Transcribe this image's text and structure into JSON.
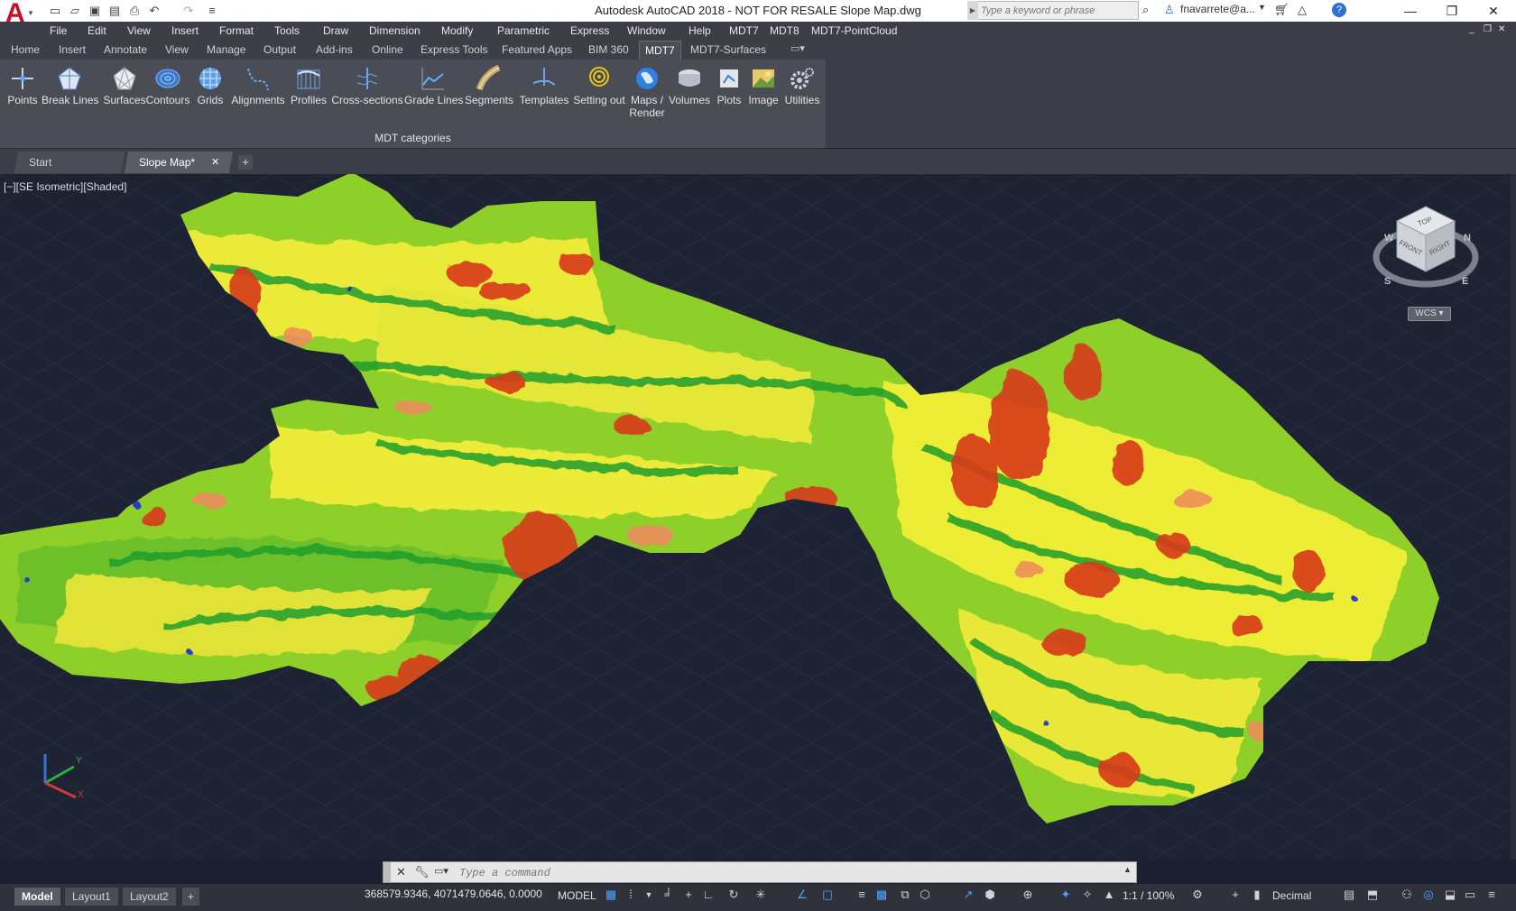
{
  "window": {
    "title": "Autodesk AutoCAD 2018 - NOT FOR RESALE    Slope Map.dwg",
    "search_placeholder": "Type a keyword or phrase",
    "user": "fnavarrete@a...",
    "app_letter": "A"
  },
  "menu": [
    "File",
    "Edit",
    "View",
    "Insert",
    "Format",
    "Tools",
    "Draw",
    "Dimension",
    "Modify",
    "Parametric",
    "Express",
    "Window",
    "Help",
    "MDT7",
    "MDT8",
    "MDT7-PointCloud"
  ],
  "ribbon_tabs": [
    "Home",
    "Insert",
    "Annotate",
    "View",
    "Manage",
    "Output",
    "Add-ins",
    "Online",
    "Express Tools",
    "Featured Apps",
    "BIM 360",
    "MDT7",
    "MDT7-Surfaces"
  ],
  "ribbon_active_tab": "MDT7",
  "ribbon_tools": [
    {
      "label": "Points",
      "icon": "points-icon"
    },
    {
      "label": "Break Lines",
      "icon": "break-lines-icon"
    },
    {
      "label": "Surfaces",
      "icon": "surfaces-icon"
    },
    {
      "label": "Contours",
      "icon": "contours-icon"
    },
    {
      "label": "Grids",
      "icon": "grids-icon"
    },
    {
      "label": "Alignments",
      "icon": "alignments-icon"
    },
    {
      "label": "Profiles",
      "icon": "profiles-icon"
    },
    {
      "label": "Cross-sections",
      "icon": "cross-sections-icon"
    },
    {
      "label": "Grade Lines",
      "icon": "grade-lines-icon"
    },
    {
      "label": "Segments",
      "icon": "segments-icon"
    },
    {
      "label": "Templates",
      "icon": "templates-icon"
    },
    {
      "label": "Setting out",
      "icon": "setting-out-icon"
    },
    {
      "label": "Maps /",
      "label2": "Render",
      "icon": "maps-render-icon"
    },
    {
      "label": "Volumes",
      "icon": "volumes-icon"
    },
    {
      "label": "Plots",
      "icon": "plots-icon"
    },
    {
      "label": "Image",
      "icon": "image-icon"
    },
    {
      "label": "Utilities",
      "icon": "utilities-icon"
    }
  ],
  "ribbon_panel_caption": "MDT categories",
  "doc_tabs": [
    "Start",
    "Slope Map*"
  ],
  "viewport": {
    "label": "[−][SE Isometric][Shaded]",
    "viewcube": {
      "top": "TOP",
      "front": "FRONT",
      "right": "RIGHT",
      "compass": [
        "W",
        "N",
        "S",
        "E"
      ],
      "ucs": "WCS"
    },
    "ucs_axes": {
      "x": "X",
      "y": "Y"
    }
  },
  "command_line": {
    "placeholder": "Type a command"
  },
  "layout_tabs": [
    "Model",
    "Layout1",
    "Layout2"
  ],
  "status": {
    "coordinates": "368579.9346, 4071479.0646, 0.0000",
    "space": "MODEL",
    "scale": "1:1 / 100%",
    "units": "Decimal"
  },
  "colors": {
    "accent": "#c8102e",
    "slope_low": "#1f9e2b",
    "slope_mid": "#9ed629",
    "slope_high": "#f2ef36",
    "slope_steep": "#d83a1a",
    "water": "#1a2fd0"
  }
}
